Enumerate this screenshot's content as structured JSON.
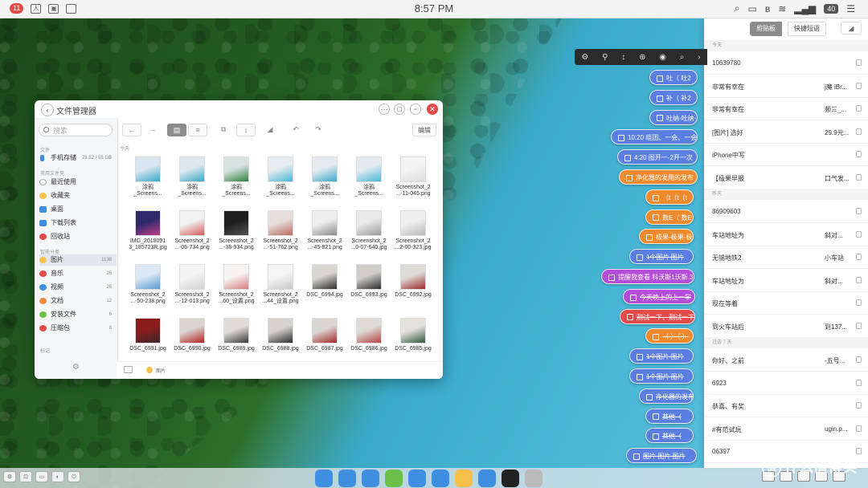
{
  "menubar": {
    "badge": "11",
    "time": "8:57 PM",
    "battery": "40"
  },
  "file_manager": {
    "title": "文件管理器",
    "search_placeholder": "搜索",
    "edit_label": "编辑",
    "day_label": "今天",
    "sidebar": {
      "section_files": "文件",
      "storage_label": "手机存储",
      "storage_value": "28.52 / 55 GB",
      "section_common": "常用文件夹",
      "common": [
        {
          "label": "最近使用",
          "color": "#e8e8e8"
        },
        {
          "label": "收藏夹",
          "color": "#f6c14b"
        },
        {
          "label": "桌面",
          "color": "#3e8fe0"
        },
        {
          "label": "下载列表",
          "color": "#3e8fe0"
        },
        {
          "label": "回收站",
          "color": "#e34b4b"
        }
      ],
      "section_smart": "智能分类",
      "smart": [
        {
          "label": "图片",
          "count": "1138",
          "color": "#f6c14b"
        },
        {
          "label": "音乐",
          "count": "26",
          "color": "#e34b4b"
        },
        {
          "label": "视频",
          "count": "26",
          "color": "#3e8fe0"
        },
        {
          "label": "文档",
          "count": "12",
          "color": "#f08a3c"
        },
        {
          "label": "安装文件",
          "count": "6",
          "color": "#6cc04a"
        },
        {
          "label": "压缩包",
          "count": "8",
          "color": "#e34b4b"
        }
      ],
      "section_tags": "标记"
    },
    "status_path": "图片",
    "files": [
      {
        "name": "涂鸦\n_Screens...",
        "c1": "#d9e6ef",
        "c2": "#3aa9c9"
      },
      {
        "name": "涂鸦\n_Screens...",
        "c1": "#dfe8ee",
        "c2": "#3aa9c9"
      },
      {
        "name": "涂鸦\n_Screens...",
        "c1": "#d6e2df",
        "c2": "#2f7e3d"
      },
      {
        "name": "涂鸦\n_Screens...",
        "c1": "#e6ecf0",
        "c2": "#48b7d6"
      },
      {
        "name": "涂鸦\n_Screens...",
        "c1": "#e4eaf0",
        "c2": "#3aa9c9"
      },
      {
        "name": "涂鸦\n_Screens...",
        "c1": "#e2eaf0",
        "c2": "#48b7d6"
      },
      {
        "name": "Screenshot_2\n...-11-045.png",
        "c1": "#f4f4f4",
        "c2": "#dcdcdc"
      },
      {
        "name": "IMG_2018091\n3_185723R.jpg",
        "c1": "#2c2a6a",
        "c2": "#c43c8a"
      },
      {
        "name": "Screenshot_2\n...-06-734.png",
        "c1": "#f2f2f2",
        "c2": "#d65a5a"
      },
      {
        "name": "Screenshot_2\n...-38-934.png",
        "c1": "#1e1e1e",
        "c2": "#555555"
      },
      {
        "name": "Screenshot_2\n...-51-762.png",
        "c1": "#e7dedb",
        "c2": "#b86a62"
      },
      {
        "name": "Screenshot_2\n...-45-821.png",
        "c1": "#efefef",
        "c2": "#8a8a8a"
      },
      {
        "name": "Screenshot_2\n...0-07-640.jpg",
        "c1": "#e9e9e9",
        "c2": "#9a9a9a"
      },
      {
        "name": "Screenshot_2\n...2-00-323.jpg",
        "c1": "#efefef",
        "c2": "#b9b9b9"
      },
      {
        "name": "Screenshot_2\n...-50-238.png",
        "c1": "#dbe8f4",
        "c2": "#5a9ad6"
      },
      {
        "name": "Screenshot_2\n...-12-013.png",
        "c1": "#f4f4f4",
        "c2": "#d2d2d2"
      },
      {
        "name": "Screenshot_2\n...60_设置.png",
        "c1": "#f7f3f3",
        "c2": "#d47f7f"
      },
      {
        "name": "Screenshot_2\n...44_设置.png",
        "c1": "#f5f5f5",
        "c2": "#c9c9c9"
      },
      {
        "name": "DSC_6994.jpg",
        "c1": "#d8d4d0",
        "c2": "#2c2c2c"
      },
      {
        "name": "DSC_6993.jpg",
        "c1": "#d0ccc8",
        "c2": "#2a2a2a"
      },
      {
        "name": "DSC_6992.jpg",
        "c1": "#dedad6",
        "c2": "#9b2a2a"
      },
      {
        "name": "DSC_6991.jpg",
        "c1": "#8a1c1c",
        "c2": "#3a2a2a"
      },
      {
        "name": "DSC_6990.jpg",
        "c1": "#d8d4d0",
        "c2": "#b52222"
      },
      {
        "name": "DSC_6989.jpg",
        "c1": "#e0dcd8",
        "c2": "#3a3a3a"
      },
      {
        "name": "DSC_6988.jpg",
        "c1": "#d6d2ce",
        "c2": "#2c2c2c"
      },
      {
        "name": "DSC_6987.jpg",
        "c1": "#d9d5d1",
        "c2": "#a52a2a"
      },
      {
        "name": "DSC_6986.jpg",
        "c1": "#dedad6",
        "c2": "#b34242"
      },
      {
        "name": "DSC_6985.jpg",
        "c1": "#e4e0dc",
        "c2": "#2f5a3a"
      }
    ]
  },
  "floating_toolbar": {
    "icons": [
      "gear-icon",
      "filter-icon",
      "sort-icon",
      "add-icon",
      "eye-icon",
      "search-icon",
      "arrow-right-icon"
    ]
  },
  "pills": [
    {
      "text": "吐（ 吐2",
      "color": "#5b7fe0",
      "done": false
    },
    {
      "text": "补（ 补2",
      "color": "#5b7fe0",
      "done": false
    },
    {
      "text": "吐纳-吐纳-a",
      "color": "#5b7fe0",
      "done": false
    },
    {
      "text": "10:20 组团、一会、一会",
      "color": "#5b7fe0",
      "done": false
    },
    {
      "text": "4:20 图开一-2开一次",
      "color": "#5b7fe0",
      "done": false
    },
    {
      "text": "净化器的发用的发布",
      "color": "#f08a2e",
      "done": false
    },
    {
      "text": "（t（t（t",
      "color": "#f08a2e",
      "done": false
    },
    {
      "text": "数E（ 数E",
      "color": "#f08a2e",
      "done": false
    },
    {
      "text": "极果-极果-极",
      "color": "#f08a2e",
      "done": false
    },
    {
      "text": "1个图片 图片",
      "color": "#5b7fe0",
      "done": true
    },
    {
      "text": "提醒我查看 科沃斯1沃斯.3",
      "color": "#b44ed8",
      "done": false
    },
    {
      "text": "今天晚上的上一学",
      "color": "#b44ed8",
      "done": true
    },
    {
      "text": "测试一下、测试一下",
      "color": "#e34b4b",
      "done": true
    },
    {
      "text": "（ ）（ ）",
      "color": "#f08a2e",
      "done": true
    },
    {
      "text": "1个图片 图片",
      "color": "#5b7fe0",
      "done": true
    },
    {
      "text": "1个图片 图片",
      "color": "#5b7fe0",
      "done": true
    },
    {
      "text": "净化器的发布",
      "color": "#5b7fe0",
      "done": true
    },
    {
      "text": "其他（",
      "color": "#5b7fe0",
      "done": true
    },
    {
      "text": "其他（",
      "color": "#5b7fe0",
      "done": true
    },
    {
      "text": "图片 图片 图片",
      "color": "#5b7fe0",
      "done": true
    }
  ],
  "clipboard": {
    "tab_clipboard": "剪贴板",
    "tab_quick": "快捷短语",
    "section_today": "今天",
    "section_yesterday": "昨天",
    "section_week": "过去 7 天",
    "today": [
      {
        "left": "10639780",
        "right": ""
      },
      {
        "left": "非常有幸在",
        "right": "j魔 iBr..."
      },
      {
        "left": "非常有幸在",
        "right": "频三_..."
      },
      {
        "left": "[图片] 选好",
        "right": "29.9元..."
      },
      {
        "left": "iPhone中写",
        "right": ""
      },
      {
        "left": "【极果早报",
        "right": "口气发..."
      }
    ],
    "yesterday": [
      {
        "left": "86909603",
        "right": ""
      },
      {
        "left": "车站地址为",
        "right": "斜对..."
      },
      {
        "left": "无锡地铁2",
        "right": "小车站"
      },
      {
        "left": "车站地址为",
        "right": "斜对..."
      },
      {
        "left": "现在等着",
        "right": ""
      },
      {
        "left": "到火车站后",
        "right": "到137..."
      }
    ],
    "week": [
      {
        "left": "你好、之前",
        "right": "-五号..."
      },
      {
        "left": "6923",
        "right": ""
      },
      {
        "left": "恭喜、有奖",
        "right": ""
      },
      {
        "left": "#有范试玩",
        "right": "ugin.p..."
      },
      {
        "left": "06397",
        "right": ""
      }
    ]
  },
  "watermark": "什么值得买",
  "dock": [
    {
      "name": "finder",
      "color": "#3e8fe0"
    },
    {
      "name": "browser",
      "color": "#3e8fe0"
    },
    {
      "name": "files",
      "color": "#3e8fe0"
    },
    {
      "name": "chat",
      "color": "#6cc04a"
    },
    {
      "name": "sync",
      "color": "#3e8fe0"
    },
    {
      "name": "editor",
      "color": "#3e8fe0"
    },
    {
      "name": "notes",
      "color": "#f6c14b"
    },
    {
      "name": "messages",
      "color": "#3e8fe0"
    },
    {
      "name": "qq",
      "color": "#222222"
    },
    {
      "name": "trash",
      "color": "#bbbbbb"
    }
  ]
}
